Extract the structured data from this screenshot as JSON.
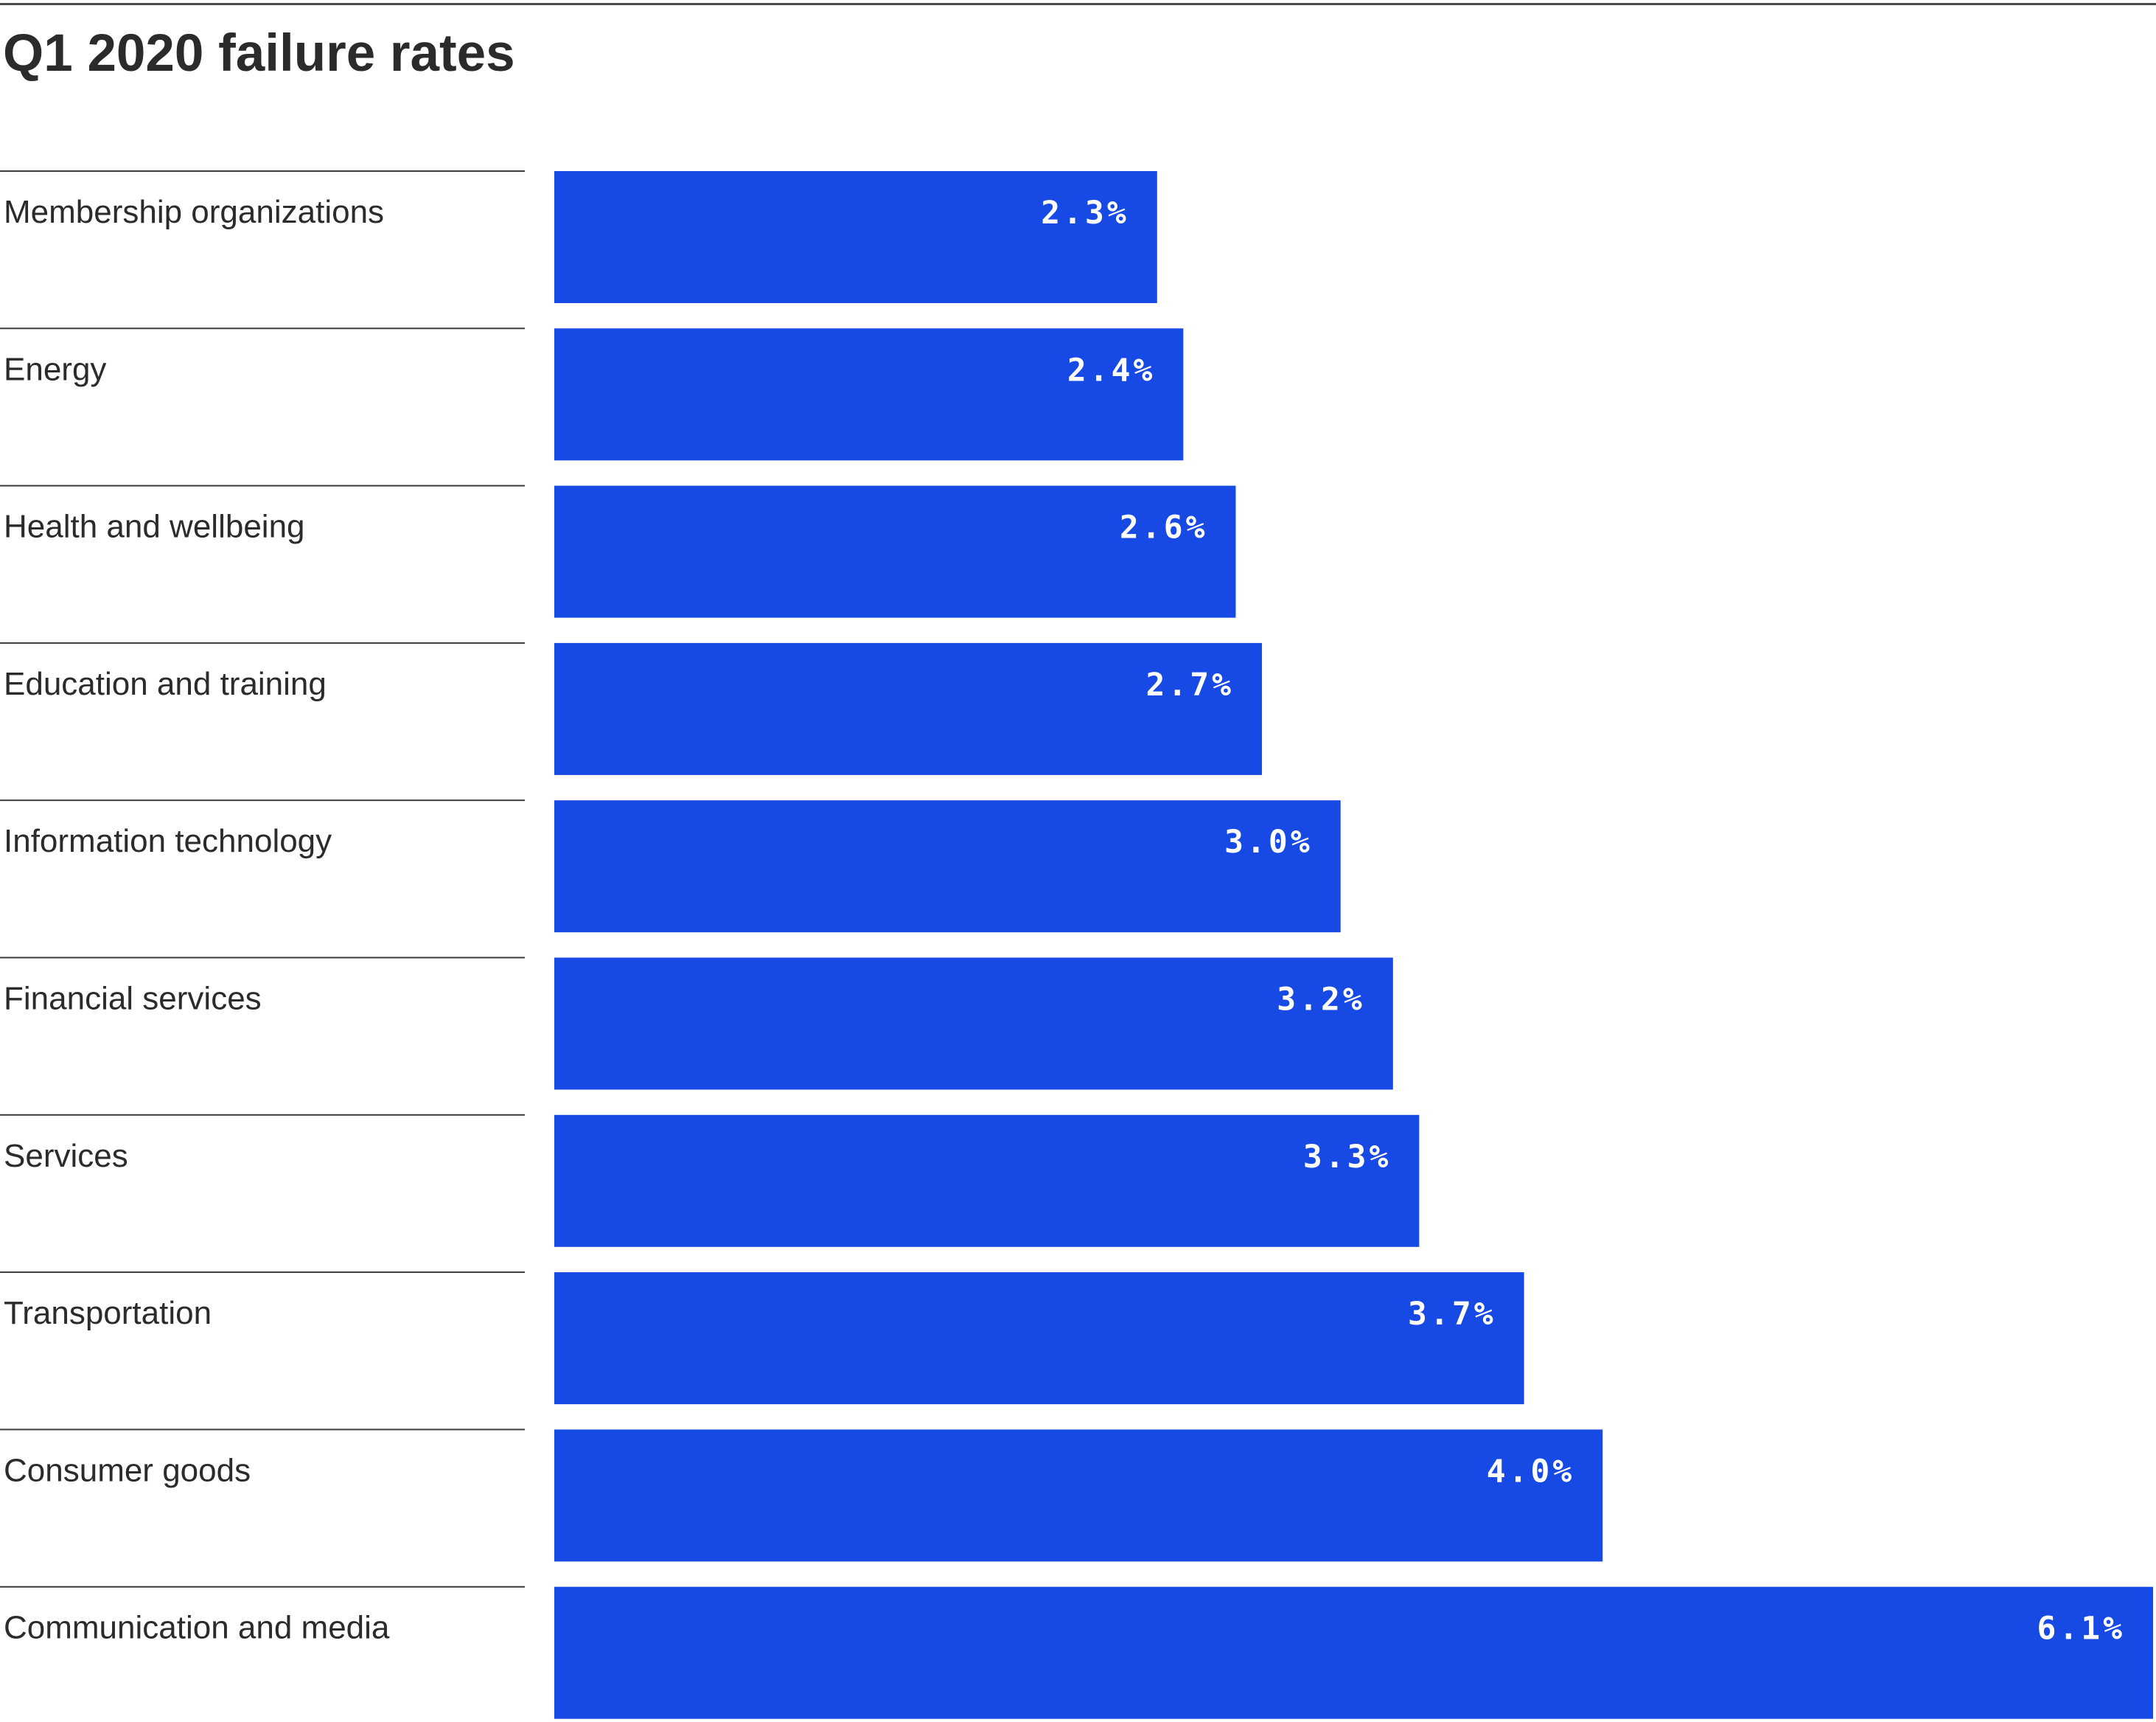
{
  "title": "Q1 2020 failure rates",
  "colors": {
    "bar": "#174AE4",
    "text": "#2b2b2b",
    "divider": "#3a3a3a",
    "value_label": "#ffffff"
  },
  "chart_data": {
    "type": "bar",
    "orientation": "horizontal",
    "title": "Q1 2020 failure rates",
    "xlabel": "",
    "ylabel": "",
    "unit": "%",
    "xlim": [
      0,
      6.1
    ],
    "grid": false,
    "legend": null,
    "categories": [
      "Membership organizations",
      "Energy",
      "Health and wellbeing",
      "Education and training",
      "Information technology",
      "Financial services",
      "Services",
      "Transportation",
      "Consumer goods",
      "Communication and media"
    ],
    "values": [
      2.3,
      2.4,
      2.6,
      2.7,
      3.0,
      3.2,
      3.3,
      3.7,
      4.0,
      6.1
    ],
    "value_labels": [
      "2.3%",
      "2.4%",
      "2.6%",
      "2.7%",
      "3.0%",
      "3.2%",
      "3.3%",
      "3.7%",
      "4.0%",
      "6.1%"
    ]
  }
}
